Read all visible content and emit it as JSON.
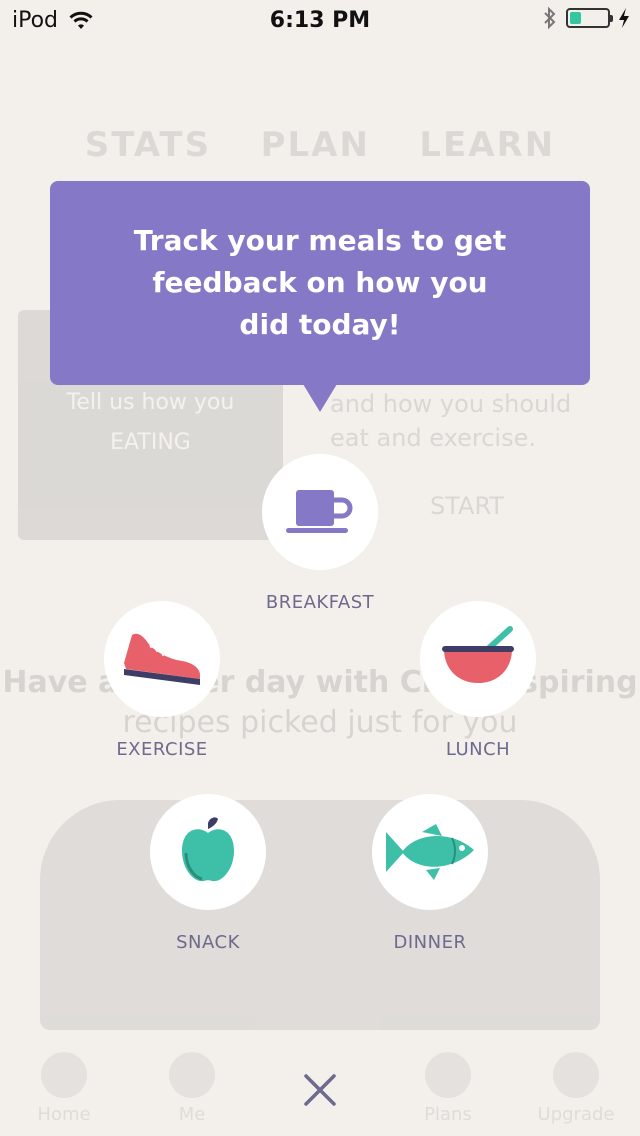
{
  "status_bar": {
    "carrier": "iPod",
    "time": "6:13 PM",
    "battery_level": 0.3,
    "battery_color": "#33c7a0"
  },
  "background": {
    "tabs": [
      "STATS",
      "PLAN",
      "LEARN"
    ],
    "card_text_1": "Tell us how you",
    "card_text_2": "EATING",
    "right_text_1": "and how you should",
    "right_text_2": "eat and exercise.",
    "right_button": "START",
    "heading_1": "Have a better day with Chef-inspiring",
    "heading_2": "recipes picked just for you",
    "nav": [
      "Home",
      "Me",
      "",
      "Plans",
      "Upgrade"
    ]
  },
  "tooltip": {
    "text": "Track your meals to get feedback on how you did today!",
    "color": "#8578c6"
  },
  "meals": {
    "breakfast": {
      "label": "BREAKFAST",
      "icon": "cup-icon"
    },
    "exercise": {
      "label": "EXERCISE",
      "icon": "sneaker-icon"
    },
    "lunch": {
      "label": "LUNCH",
      "icon": "bowl-icon"
    },
    "snack": {
      "label": "SNACK",
      "icon": "apple-icon"
    },
    "dinner": {
      "label": "DINNER",
      "icon": "fish-icon"
    }
  },
  "colors": {
    "accent_purple": "#8578c6",
    "coral": "#e8616a",
    "teal": "#3dbfa8",
    "label": "#6e6a8e"
  }
}
